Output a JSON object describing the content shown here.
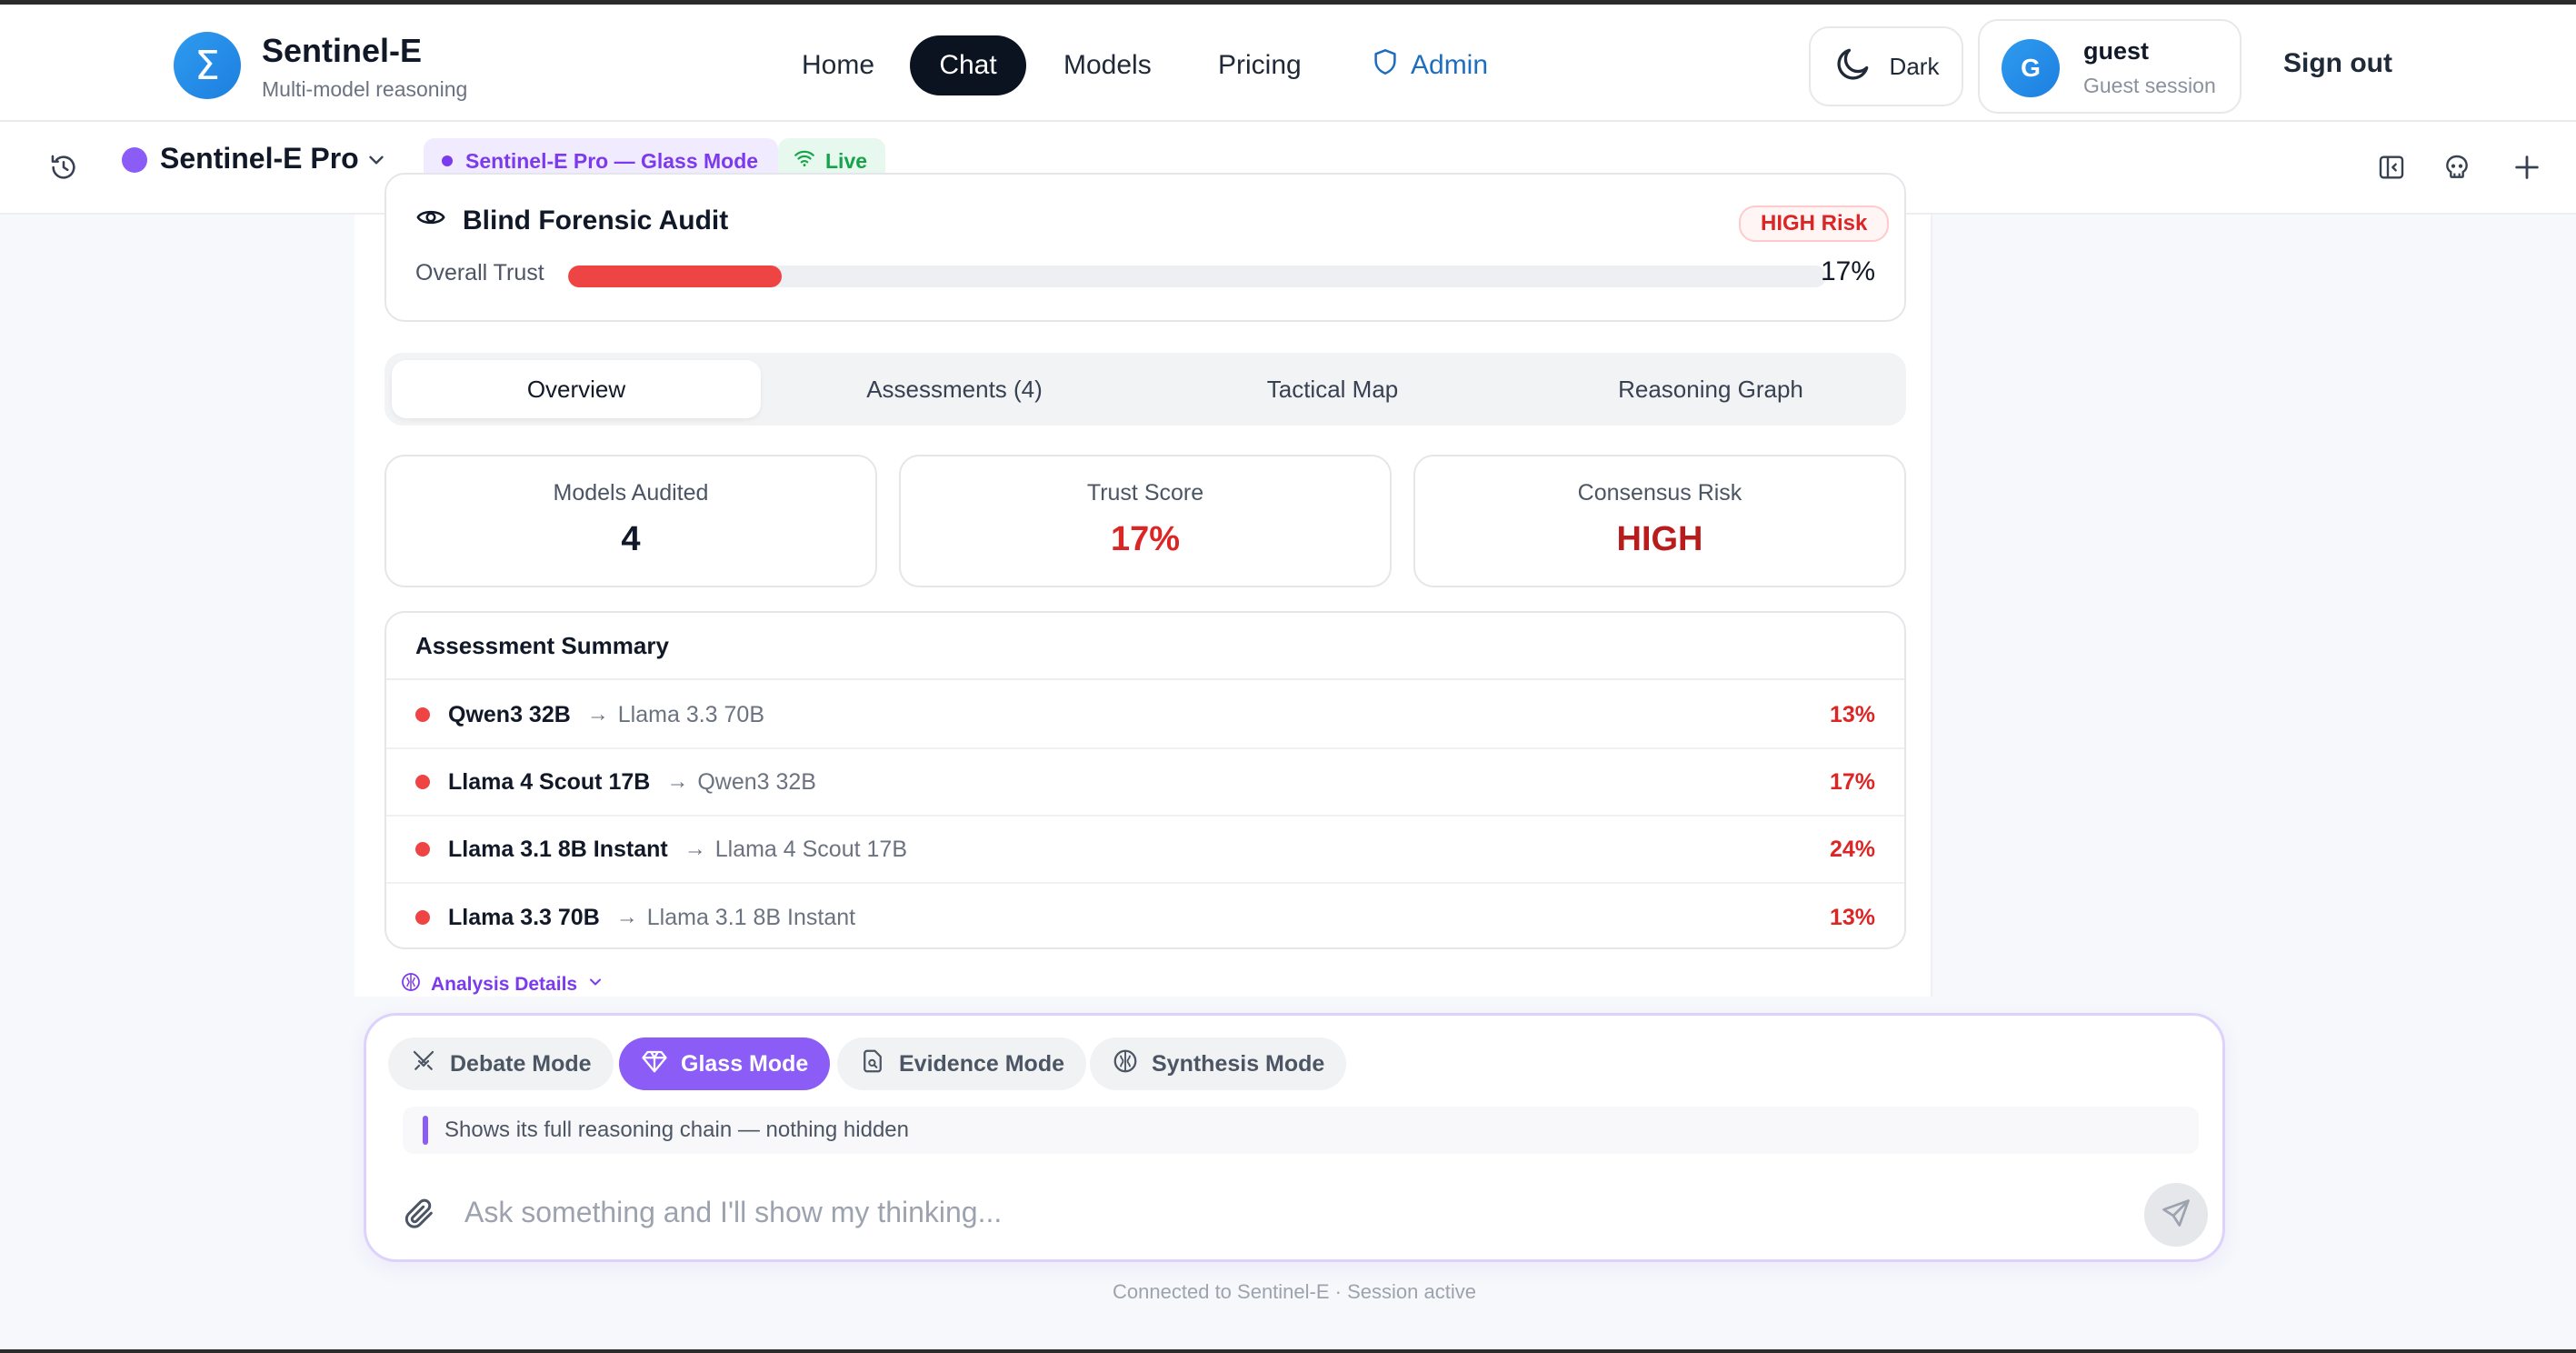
{
  "brand": {
    "name": "Sentinel-E",
    "subtitle": "Multi-model reasoning",
    "logo_glyph": "Σ",
    "accent": "#1c7fe0"
  },
  "nav": {
    "items": [
      {
        "label": "Home",
        "active": false
      },
      {
        "label": "Chat",
        "active": true
      },
      {
        "label": "Models",
        "active": false
      },
      {
        "label": "Pricing",
        "active": false
      },
      {
        "label": "Admin",
        "active": false,
        "icon": "shield-icon"
      }
    ]
  },
  "header": {
    "theme_toggle_label": "Dark",
    "theme_icon": "moon-icon",
    "user": {
      "initial": "G",
      "name": "guest",
      "session": "Guest session"
    },
    "sign_out_label": "Sign out"
  },
  "toolbar": {
    "model_name": "Sentinel-E Pro",
    "model_color": "#8b5cf6",
    "mode_badge": "Sentinel-E Pro — Glass Mode",
    "live_badge": "Live",
    "icons": [
      "history-icon",
      "sidebar-panel-icon",
      "skull-icon",
      "plus-icon"
    ]
  },
  "audit": {
    "title": "Blind Forensic Audit",
    "risk_tag": "HIGH Risk",
    "trust_label": "Overall Trust",
    "trust_value": "17%",
    "trust_fraction": 0.17,
    "bar_color": "#ef4444"
  },
  "tabs": [
    {
      "label": "Overview",
      "active": true
    },
    {
      "label": "Assessments (4)",
      "active": false
    },
    {
      "label": "Tactical Map",
      "active": false
    },
    {
      "label": "Reasoning Graph",
      "active": false
    }
  ],
  "stats": [
    {
      "label": "Models Audited",
      "value": "4",
      "color": "#111827"
    },
    {
      "label": "Trust Score",
      "value": "17%",
      "color": "#dc2626"
    },
    {
      "label": "Consensus Risk",
      "value": "HIGH",
      "color": "#b91c1c"
    }
  ],
  "summary": {
    "title": "Assessment Summary",
    "rows": [
      {
        "model": "Qwen3 32B",
        "target": "Llama 3.3 70B",
        "score": "13%"
      },
      {
        "model": "Llama 4 Scout 17B",
        "target": "Qwen3 32B",
        "score": "17%"
      },
      {
        "model": "Llama 3.1 8B Instant",
        "target": "Llama 4 Scout 17B",
        "score": "24%"
      },
      {
        "model": "Llama 3.3 70B",
        "target": "Llama 3.1 8B Instant",
        "score": "13%"
      }
    ]
  },
  "analysis_details_label": "Analysis Details",
  "composer": {
    "modes": [
      {
        "label": "Debate Mode",
        "icon": "swords-icon",
        "active": false
      },
      {
        "label": "Glass Mode",
        "icon": "gem-icon",
        "active": true
      },
      {
        "label": "Evidence Mode",
        "icon": "document-search-icon",
        "active": false
      },
      {
        "label": "Synthesis Mode",
        "icon": "brain-icon",
        "active": false
      }
    ],
    "hint": "Shows its full reasoning chain — nothing hidden",
    "placeholder": "Ask something and I'll show my thinking...",
    "value": ""
  },
  "footer_status": "Connected to Sentinel-E · Session active"
}
